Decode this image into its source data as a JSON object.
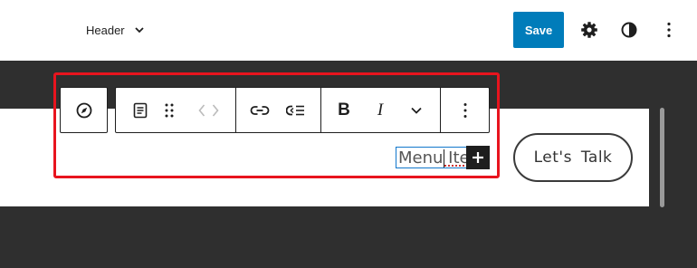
{
  "header": {
    "template_label": "Header",
    "save_label": "Save",
    "icons": [
      "chevron-down-icon",
      "gear-icon",
      "contrast-icon",
      "more-vertical-icon"
    ]
  },
  "block_toolbar": {
    "tools": [
      "navigation-icon",
      "paragraph-icon",
      "drag-handle-icon",
      "move-left-icon",
      "move-right-icon",
      "link-icon",
      "submenu-icon",
      "bold-icon",
      "italic-icon",
      "chevron-down-icon",
      "more-vertical-icon"
    ],
    "bold_glyph": "B",
    "italic_glyph": "I"
  },
  "editor": {
    "menu_item_text": "Menu Item",
    "add_button_icon": "plus-icon",
    "cta_label": "Let's  Talk"
  },
  "colors": {
    "accent": "#007cba",
    "highlight": "#e8141e",
    "dark_background": "#2f2f2f",
    "selection_border": "#1177cc"
  }
}
